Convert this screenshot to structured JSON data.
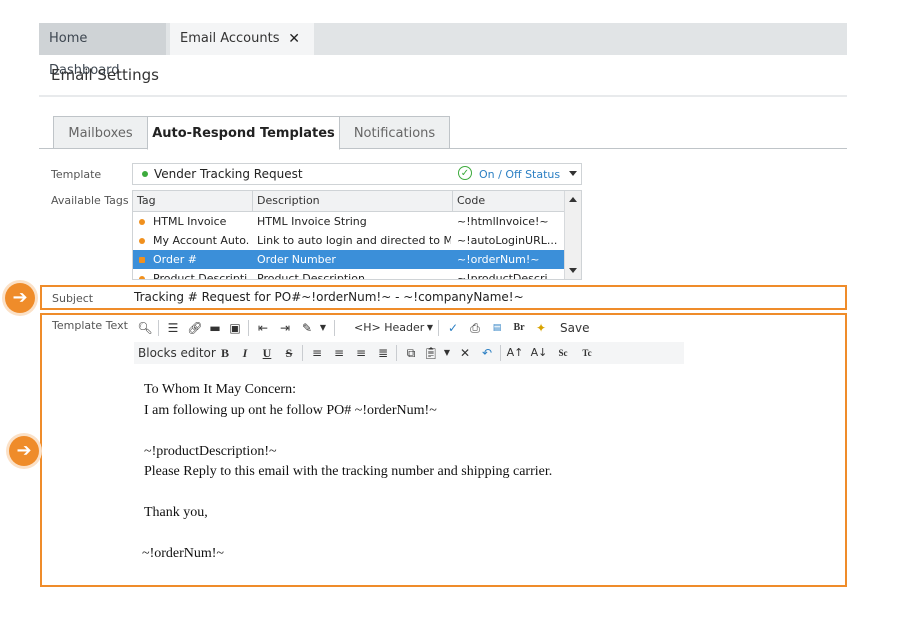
{
  "tabs": {
    "home_dashboard": "Home Dashboard",
    "email_accounts": "Email Accounts",
    "close_glyph": "✕"
  },
  "page_title": "Email Settings",
  "sub_tabs": [
    "Mailboxes",
    "Auto-Respond Templates",
    "Notifications"
  ],
  "labels": {
    "template": "Template",
    "available_tags": "Available Tags",
    "subject": "Subject",
    "template_text": "Template Text"
  },
  "template": {
    "selected": "Vender Tracking Request",
    "status": "On / Off Status",
    "status_color": "#3caa3c"
  },
  "tags_table": {
    "headers": [
      "Tag",
      "Description",
      "Code"
    ],
    "rows": [
      {
        "tag": "HTML Invoice",
        "description": "HTML Invoice String",
        "code": "~!htmlInvoice!~"
      },
      {
        "tag": "My Account Auto...",
        "description": "Link to auto login and directed to My...",
        "code": "~!autoLoginURL..."
      },
      {
        "tag": "Order #",
        "description": "Order Number",
        "code": "~!orderNum!~"
      },
      {
        "tag": "Product Descripti...",
        "description": "Product Description",
        "code": "~!productDescri..."
      }
    ]
  },
  "subject": "Tracking # Request for PO#~!orderNum!~ - ~!companyName!~",
  "toolbar": {
    "header_label": "<H> Header",
    "save_label": "Save",
    "blocks_editor": "Blocks editor"
  },
  "body_lines": [
    "To Whom It May Concern:",
    "I am following up ont he follow PO# ~!orderNum!~",
    "",
    "~!productDescription!~",
    "Please Reply to this email with the tracking number and shipping carrier.",
    "",
    "Thank you,",
    "",
    "~!orderNum!~"
  ],
  "colors": {
    "accent_orange": "#ef8c2a",
    "selection_blue": "#3b8fd9",
    "tag_dot_orange": "#f0901e",
    "link_blue": "#2b7fc3"
  }
}
